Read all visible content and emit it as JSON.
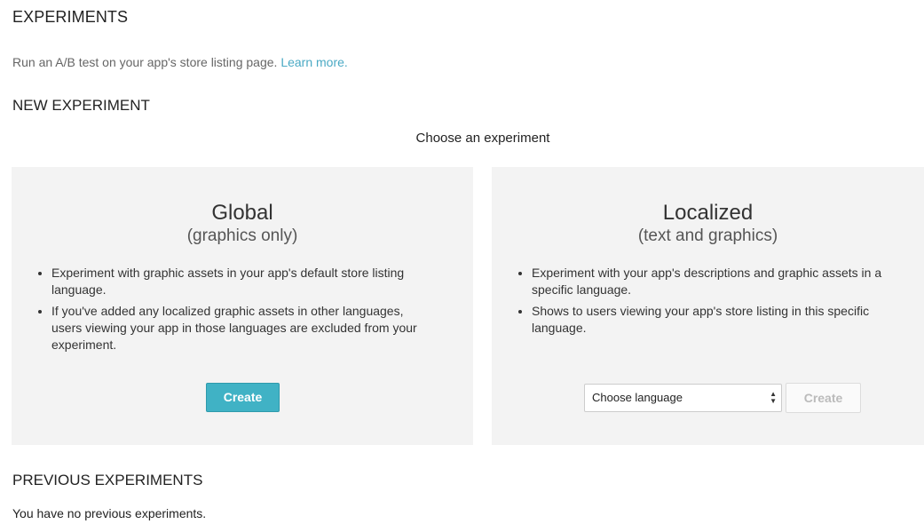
{
  "header": {
    "title": "EXPERIMENTS",
    "intro_text": "Run an A/B test on your app's store listing page. ",
    "learn_more": "Learn more."
  },
  "new_experiment": {
    "heading": "NEW EXPERIMENT",
    "choose_label": "Choose an experiment",
    "global": {
      "title": "Global",
      "subtitle": "(graphics only)",
      "bullets": [
        "Experiment with graphic assets in your app's default store listing language.",
        "If you've added any localized graphic assets in other languages, users viewing your app in those languages are excluded from your experiment."
      ],
      "create_label": "Create"
    },
    "localized": {
      "title": "Localized",
      "subtitle": "(text and graphics)",
      "bullets": [
        "Experiment with your app's descriptions and graphic assets in a specific language.",
        "Shows to users viewing your app's store listing in this specific language."
      ],
      "language_select": "Choose language",
      "create_label": "Create"
    }
  },
  "previous_experiments": {
    "heading": "PREVIOUS EXPERIMENTS",
    "empty_text": "You have no previous experiments."
  },
  "colors": {
    "accent": "#40b2c5",
    "link": "#4aa9c4",
    "card_bg": "#f3f3f3"
  }
}
